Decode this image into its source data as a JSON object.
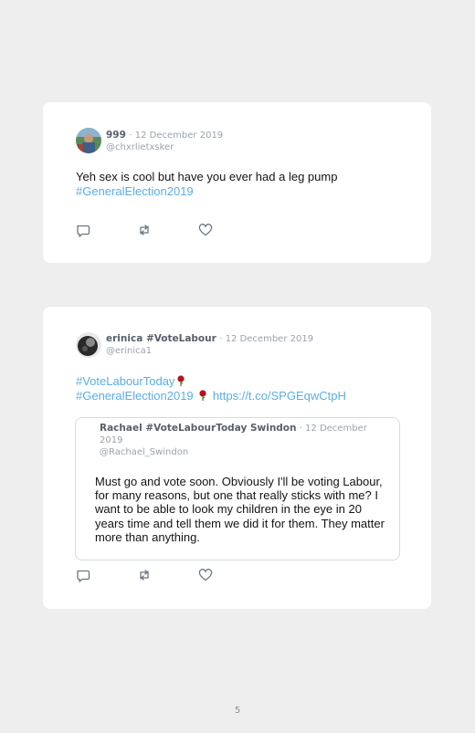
{
  "tweets": [
    {
      "name": "999",
      "date": "· 12 December 2019",
      "handle": "@chxrlietxsker",
      "text_line1": "Yeh sex is cool but have you ever had a leg pump",
      "hashtag": "#GeneralElection2019"
    },
    {
      "name": "erinica #VoteLabour",
      "date": "· 12 December 2019",
      "handle": "@erinica1",
      "hashtag1": "#VoteLabourToday",
      "hashtag2": "#GeneralElection2019",
      "url": "https://t.co/SPGEqwCtpH",
      "quote": {
        "name": "Rachael #VoteLabourToday Swindon",
        "date": "· 12 December 2019",
        "handle": "@Rachael_Swindon",
        "text": "Must go and vote soon. Obviously I'll be voting Labour, for many reasons, but one that really sticks with me? I want to be able to look my children in the eye in 20 years time and tell them we did it for them. They matter more than anything."
      }
    }
  ],
  "page_number": "5",
  "icons": [
    "reply-icon",
    "retweet-icon",
    "like-icon",
    "rose-emoji"
  ],
  "colors": {
    "link": "#5aaee5",
    "background": "#eeeeee",
    "card": "#ffffff"
  }
}
